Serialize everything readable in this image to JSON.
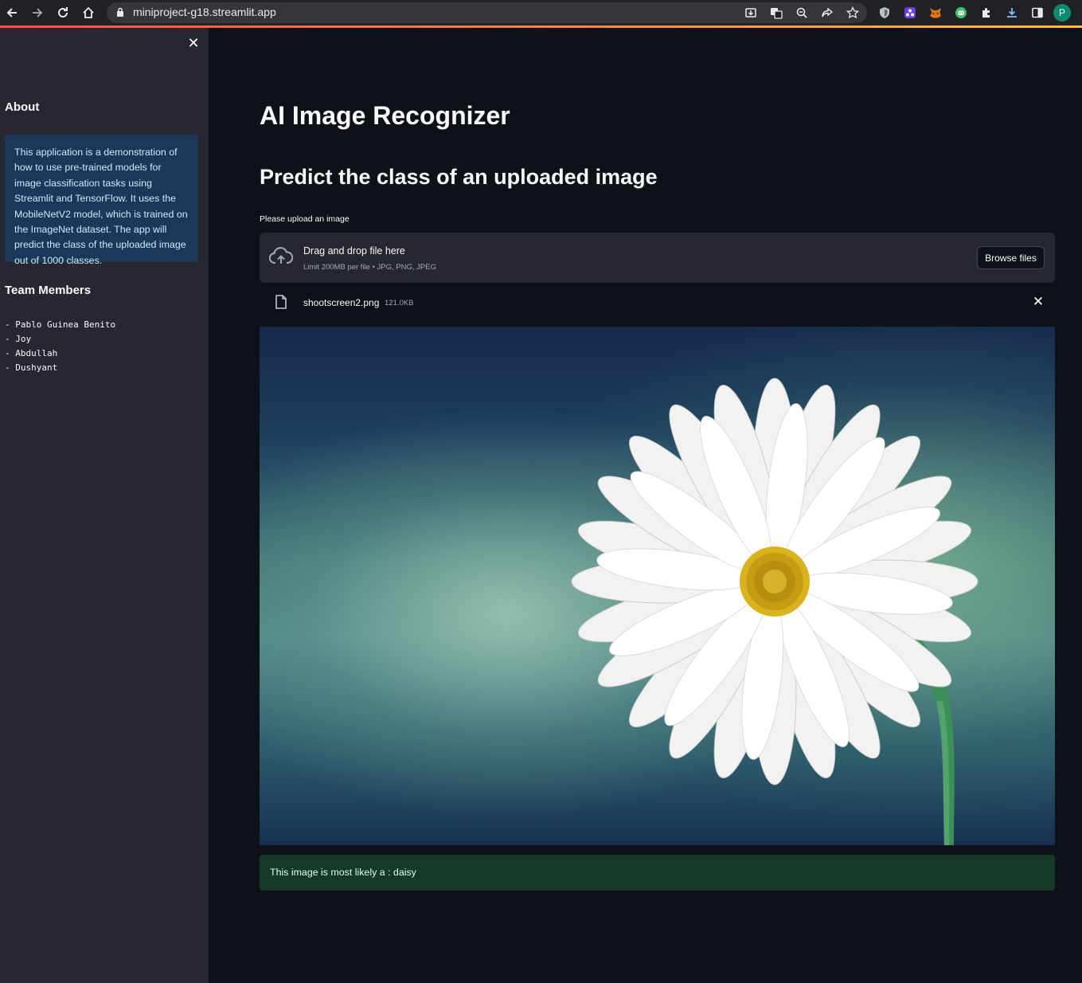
{
  "browser": {
    "url": "miniproject-g18.streamlit.app",
    "profile_initial": "P"
  },
  "sidebar": {
    "about_heading": "About",
    "about_text": "This application is a demonstration of how to use pre-trained models for image classification tasks using Streamlit and TensorFlow. It uses the MobileNetV2 model, which is trained on the ImageNet dataset. The app will predict the class of the uploaded image out of 1000 classes.",
    "team_heading": "Team Members",
    "members": [
      "- Pablo Guinea Benito",
      "- Joy",
      "- Abdullah",
      "- Dushyant"
    ]
  },
  "main": {
    "title": "AI Image Recognizer",
    "subtitle": "Predict the class of an uploaded image",
    "upload_label": "Please upload an image",
    "dropzone_title": "Drag and drop file here",
    "dropzone_limit": "Limit 200MB per file • JPG, PNG, JPEG",
    "browse_button": "Browse files",
    "file": {
      "name": "shootscreen2.png",
      "size": "121.0KB"
    },
    "result_text": "This image is most likely a : daisy"
  },
  "colors": {
    "background": "#0e1117",
    "sidebar": "#262730",
    "info_box": "#1c3858",
    "success_box": "#173928",
    "accent": "#ff4b4b"
  }
}
